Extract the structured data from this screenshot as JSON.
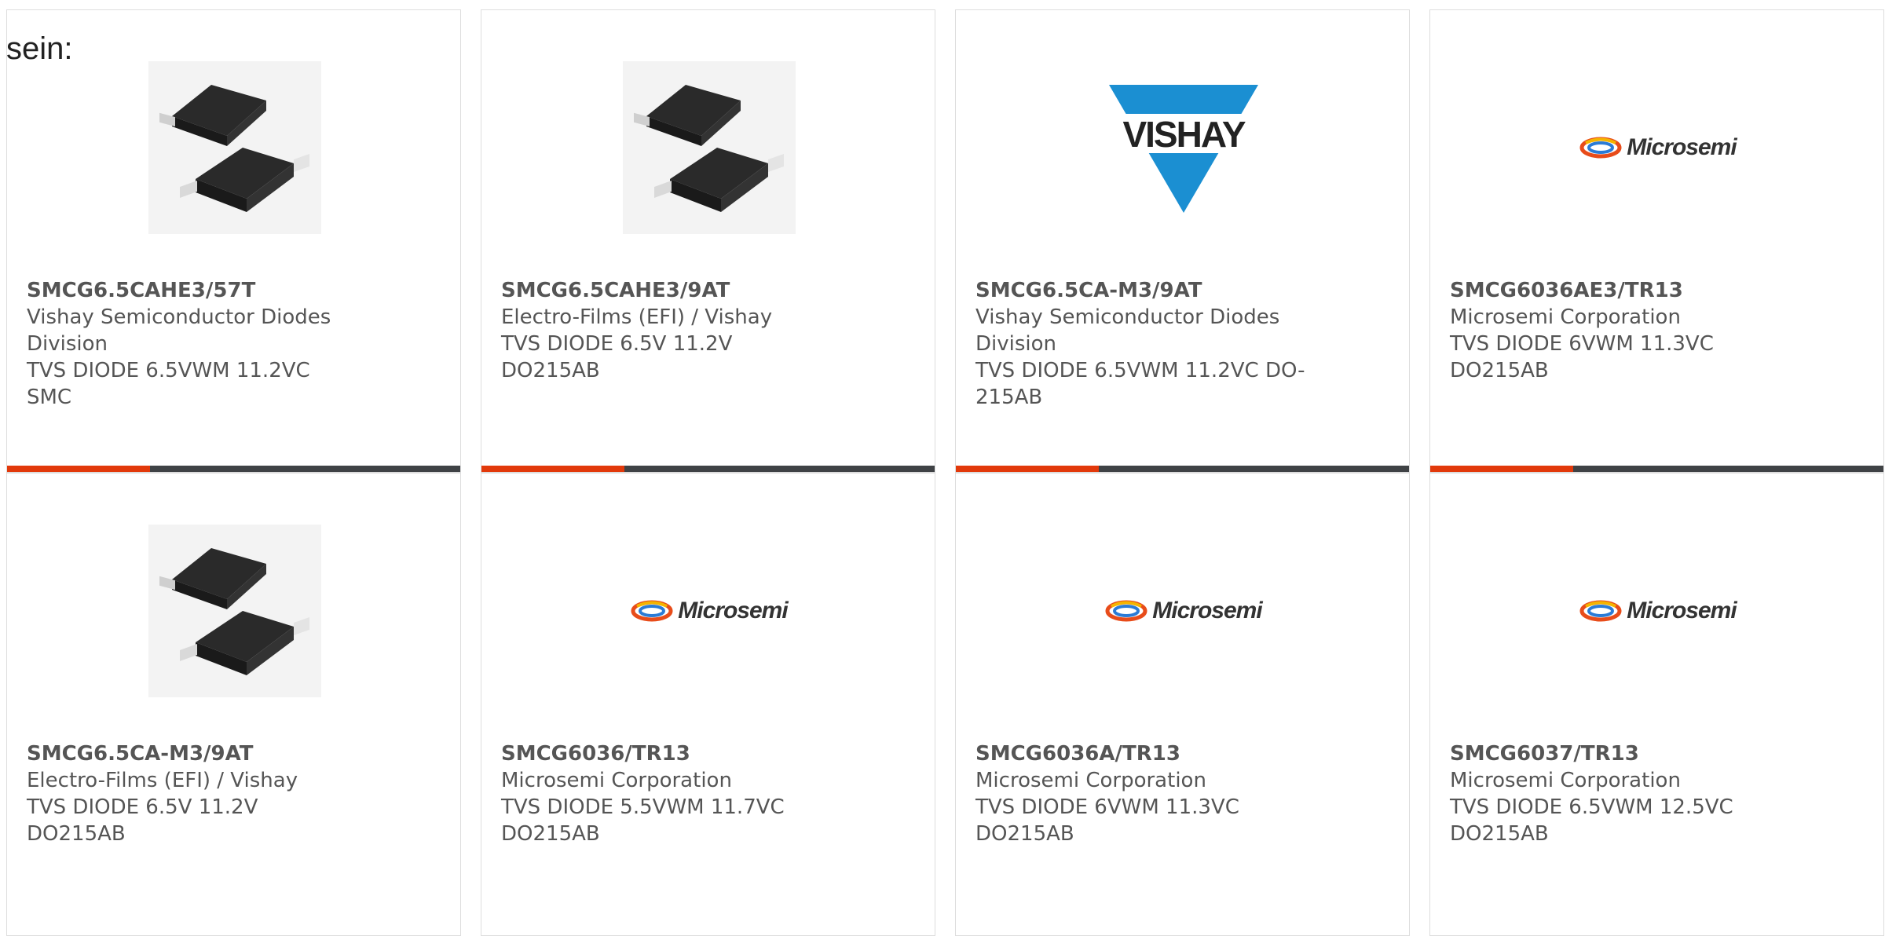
{
  "page": {
    "prefix_text": "sein:"
  },
  "colors": {
    "accent": "#e2390b",
    "bar": "#3f4245",
    "text": "#555555",
    "border": "#dddddd",
    "vishay_blue": "#1b8fd2"
  },
  "products": [
    {
      "part_number": "SMCG6.5CAHE3/57T",
      "manufacturer": "Vishay Semiconductor Diodes Division",
      "description": "TVS DIODE 6.5VWM 11.2VC SMC",
      "image": "smc-package-photo"
    },
    {
      "part_number": "SMCG6.5CAHE3/9AT",
      "manufacturer": "Electro-Films (EFI) / Vishay",
      "description": "TVS DIODE 6.5V 11.2V DO215AB",
      "image": "smc-package-photo"
    },
    {
      "part_number": "SMCG6.5CA-M3/9AT",
      "manufacturer": "Vishay Semiconductor Diodes Division",
      "description": "TVS DIODE 6.5VWM 11.2VC DO-215AB",
      "image": "vishay-logo"
    },
    {
      "part_number": "SMCG6036AE3/TR13",
      "manufacturer": "Microsemi Corporation",
      "description": "TVS DIODE 6VWM 11.3VC DO215AB",
      "image": "microsemi-logo"
    },
    {
      "part_number": "SMCG6.5CA-M3/9AT",
      "manufacturer": "Electro-Films (EFI) / Vishay",
      "description": "TVS DIODE 6.5V 11.2V DO215AB",
      "image": "smc-package-photo"
    },
    {
      "part_number": "SMCG6036/TR13",
      "manufacturer": "Microsemi Corporation",
      "description": "TVS DIODE 5.5VWM 11.7VC DO215AB",
      "image": "microsemi-logo"
    },
    {
      "part_number": "SMCG6036A/TR13",
      "manufacturer": "Microsemi Corporation",
      "description": "TVS DIODE 6VWM 11.3VC DO215AB",
      "image": "microsemi-logo"
    },
    {
      "part_number": "SMCG6037/TR13",
      "manufacturer": "Microsemi Corporation",
      "description": "TVS DIODE 6.5VWM 12.5VC DO215AB",
      "image": "microsemi-logo"
    }
  ],
  "logos": {
    "vishay": "VISHAY",
    "microsemi": "Microsemi"
  }
}
